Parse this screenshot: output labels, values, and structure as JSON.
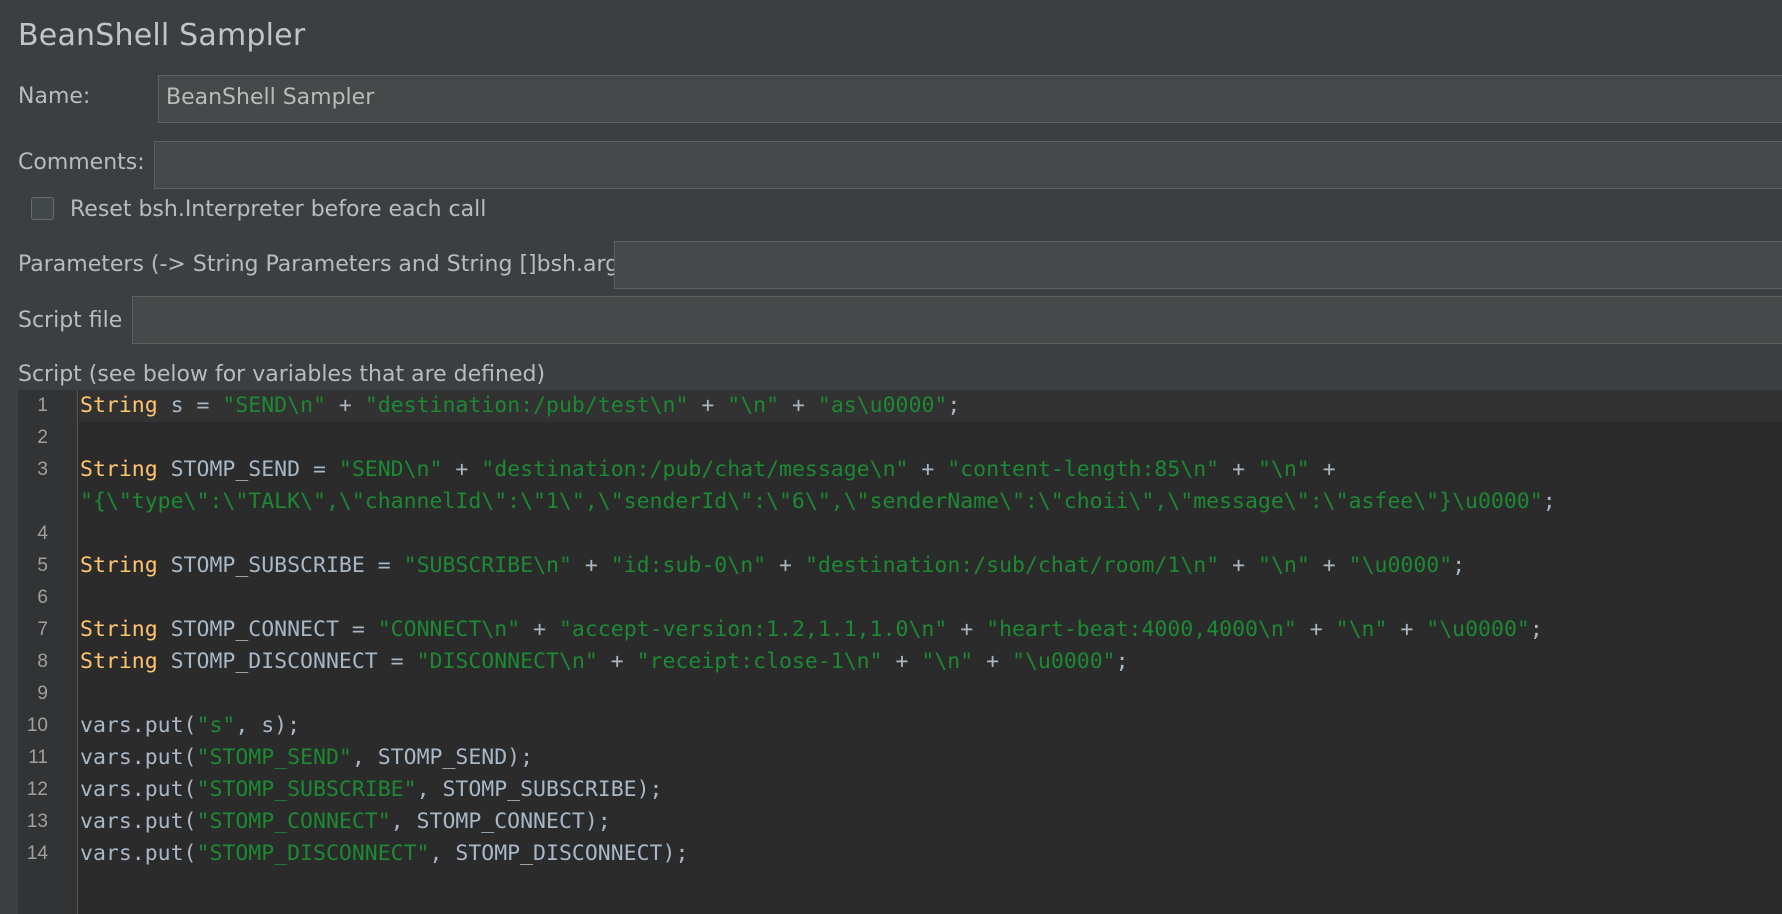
{
  "panel": {
    "title": "BeanShell Sampler"
  },
  "form": {
    "name_label": "Name:",
    "name_value": "BeanShell Sampler",
    "comments_label": "Comments:",
    "comments_value": "",
    "reset_label": "Reset bsh.Interpreter before each call",
    "reset_checked": false,
    "parameters_label": "Parameters (-> String Parameters and String []bsh.args)",
    "parameters_value": "",
    "script_file_label": "Script file",
    "script_file_value": "",
    "script_label": "Script (see below for variables that are defined)"
  },
  "editor": {
    "lines": [
      {
        "num": "1",
        "tokens": [
          {
            "t": "kw",
            "v": "String"
          },
          {
            "t": "p",
            "v": " s = "
          },
          {
            "t": "str",
            "v": "\"SEND\\n\""
          },
          {
            "t": "p",
            "v": " + "
          },
          {
            "t": "str",
            "v": "\"destination:/pub/test\\n\""
          },
          {
            "t": "p",
            "v": " + "
          },
          {
            "t": "str",
            "v": "\"\\n\""
          },
          {
            "t": "p",
            "v": " + "
          },
          {
            "t": "str",
            "v": "\"as\\u0000\""
          },
          {
            "t": "p",
            "v": ";"
          }
        ]
      },
      {
        "num": "2",
        "tokens": []
      },
      {
        "num": "3",
        "tokens": [
          {
            "t": "kw",
            "v": "String"
          },
          {
            "t": "p",
            "v": " STOMP_SEND = "
          },
          {
            "t": "str",
            "v": "\"SEND\\n\""
          },
          {
            "t": "p",
            "v": " + "
          },
          {
            "t": "str",
            "v": "\"destination:/pub/chat/message\\n\""
          },
          {
            "t": "p",
            "v": " + "
          },
          {
            "t": "str",
            "v": "\"content-length:85\\n\""
          },
          {
            "t": "p",
            "v": " + "
          },
          {
            "t": "str",
            "v": "\"\\n\""
          },
          {
            "t": "p",
            "v": " +"
          }
        ]
      },
      {
        "num": "",
        "tokens": [
          {
            "t": "str",
            "v": "\"{\\\"type\\\":\\\"TALK\\\",\\\"channelId\\\":\\\"1\\\",\\\"senderId\\\":\\\"6\\\",\\\"senderName\\\":\\\"choii\\\",\\\"message\\\":\\\"asfee\\\"}\\u0000\""
          },
          {
            "t": "p",
            "v": ";"
          }
        ]
      },
      {
        "num": "4",
        "tokens": []
      },
      {
        "num": "5",
        "tokens": [
          {
            "t": "kw",
            "v": "String"
          },
          {
            "t": "p",
            "v": " STOMP_SUBSCRIBE = "
          },
          {
            "t": "str",
            "v": "\"SUBSCRIBE\\n\""
          },
          {
            "t": "p",
            "v": " + "
          },
          {
            "t": "str",
            "v": "\"id:sub-0\\n\""
          },
          {
            "t": "p",
            "v": " + "
          },
          {
            "t": "str",
            "v": "\"destination:/sub/chat/room/1\\n\""
          },
          {
            "t": "p",
            "v": " + "
          },
          {
            "t": "str",
            "v": "\"\\n\""
          },
          {
            "t": "p",
            "v": " + "
          },
          {
            "t": "str",
            "v": "\"\\u0000\""
          },
          {
            "t": "p",
            "v": ";"
          }
        ]
      },
      {
        "num": "6",
        "tokens": []
      },
      {
        "num": "7",
        "tokens": [
          {
            "t": "kw",
            "v": "String"
          },
          {
            "t": "p",
            "v": " STOMP_CONNECT = "
          },
          {
            "t": "str",
            "v": "\"CONNECT\\n\""
          },
          {
            "t": "p",
            "v": " + "
          },
          {
            "t": "str",
            "v": "\"accept-version:1.2,1.1,1.0\\n\""
          },
          {
            "t": "p",
            "v": " + "
          },
          {
            "t": "str",
            "v": "\"heart-beat:4000,4000\\n\""
          },
          {
            "t": "p",
            "v": " + "
          },
          {
            "t": "str",
            "v": "\"\\n\""
          },
          {
            "t": "p",
            "v": " + "
          },
          {
            "t": "str",
            "v": "\"\\u0000\""
          },
          {
            "t": "p",
            "v": ";"
          }
        ]
      },
      {
        "num": "8",
        "tokens": [
          {
            "t": "kw",
            "v": "String"
          },
          {
            "t": "p",
            "v": " STOMP_DISCONNECT = "
          },
          {
            "t": "str",
            "v": "\"DISCONNECT\\n\""
          },
          {
            "t": "p",
            "v": " + "
          },
          {
            "t": "str",
            "v": "\"receipt:close-1\\n\""
          },
          {
            "t": "p",
            "v": " + "
          },
          {
            "t": "str",
            "v": "\"\\n\""
          },
          {
            "t": "p",
            "v": " + "
          },
          {
            "t": "str",
            "v": "\"\\u0000\""
          },
          {
            "t": "p",
            "v": ";"
          }
        ]
      },
      {
        "num": "9",
        "tokens": []
      },
      {
        "num": "10",
        "tokens": [
          {
            "t": "p",
            "v": "vars.put("
          },
          {
            "t": "str",
            "v": "\"s\""
          },
          {
            "t": "p",
            "v": ", s);"
          }
        ]
      },
      {
        "num": "11",
        "tokens": [
          {
            "t": "p",
            "v": "vars.put("
          },
          {
            "t": "str",
            "v": "\"STOMP_SEND\""
          },
          {
            "t": "p",
            "v": ", STOMP_SEND);"
          }
        ]
      },
      {
        "num": "12",
        "tokens": [
          {
            "t": "p",
            "v": "vars.put("
          },
          {
            "t": "str",
            "v": "\"STOMP_SUBSCRIBE\""
          },
          {
            "t": "p",
            "v": ", STOMP_SUBSCRIBE);"
          }
        ]
      },
      {
        "num": "13",
        "tokens": [
          {
            "t": "p",
            "v": "vars.put("
          },
          {
            "t": "str",
            "v": "\"STOMP_CONNECT\""
          },
          {
            "t": "p",
            "v": ", STOMP_CONNECT);"
          }
        ]
      },
      {
        "num": "14",
        "tokens": [
          {
            "t": "p",
            "v": "vars.put("
          },
          {
            "t": "str",
            "v": "\"STOMP_DISCONNECT\""
          },
          {
            "t": "p",
            "v": ", STOMP_DISCONNECT);"
          }
        ]
      }
    ]
  },
  "colors": {
    "background": "#3c3f41",
    "editor_background": "#2b2b2b",
    "keyword": "#ffc66d",
    "string": "#1b8a32",
    "plain_code": "#a9b7c6"
  }
}
